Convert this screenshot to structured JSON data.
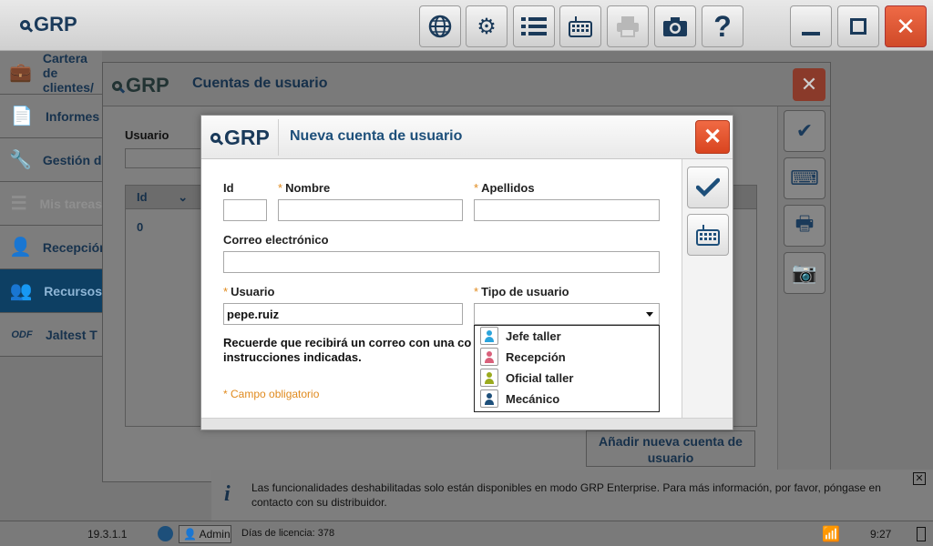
{
  "app": {
    "logo": "GRP"
  },
  "toolbar": {
    "globe_icon": "globe-icon",
    "settings_icon": "gear-icon",
    "list_icon": "list-icon",
    "keyboard_icon": "keyboard-icon",
    "print_icon": "printer-icon",
    "camera_icon": "camera-icon",
    "help_icon": "help-icon"
  },
  "sidebar": {
    "items": [
      {
        "label": "Cartera de clientes/",
        "icon": "briefcase-icon"
      },
      {
        "label": "Informes",
        "icon": "document-icon"
      },
      {
        "label": "Gestión de",
        "icon": "wrench-icon"
      },
      {
        "label": "Mis tareas",
        "icon": "tasks-icon"
      },
      {
        "label": "Recepción",
        "icon": "person-icon"
      },
      {
        "label": "Recursos",
        "icon": "people-icon"
      },
      {
        "label": "Jaltest T",
        "icon": "odf-icon",
        "prefix": "ODF"
      }
    ]
  },
  "bg_dialog": {
    "logo": "GRP",
    "title": "Cuentas de usuario",
    "user_label": "Usuario",
    "table": {
      "header": "Id",
      "rows": [
        "0"
      ]
    },
    "add_button": "Añadir nueva cuenta de usuario"
  },
  "modal": {
    "logo": "GRP",
    "title": "Nueva cuenta de usuario",
    "fields": {
      "id_label": "Id",
      "id_value": "",
      "nombre_label": "Nombre",
      "nombre_value": "",
      "apellidos_label": "Apellidos",
      "apellidos_value": "",
      "correo_label": "Correo electrónico",
      "correo_value": "",
      "usuario_label": "Usuario",
      "usuario_value": "pepe.ruiz",
      "tipo_label": "Tipo de usuario",
      "tipo_value": ""
    },
    "required_mark": "*",
    "note": "Recuerde que recibirá un correo con una co instrucciones indicadas.",
    "required_note": "* Campo obligatorio",
    "user_types": [
      {
        "label": "Jefe taller",
        "color": "#2aa4dc"
      },
      {
        "label": "Recepción",
        "color": "#d9607a"
      },
      {
        "label": "Oficial taller",
        "color": "#9aaa1e"
      },
      {
        "label": "Mecánico",
        "color": "#1d4f7a"
      }
    ]
  },
  "info": {
    "text": "Las funcionalidades deshabilitadas solo están disponibles en modo GRP Enterprise. Para más información, por favor, póngase en contacto con su distribuidor."
  },
  "status": {
    "version": "19.3.1.1",
    "user": "Admin",
    "license": "Días de licencia: 378",
    "time": "9:27"
  }
}
